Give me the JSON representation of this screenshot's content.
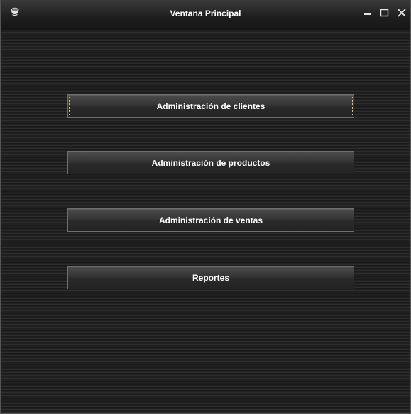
{
  "window": {
    "title": "Ventana Principal",
    "icon": "coffee-cup-icon",
    "controls": {
      "minimize_icon": "minimize-icon",
      "maximize_icon": "maximize-icon",
      "close_icon": "close-icon"
    }
  },
  "menu": {
    "buttons": [
      {
        "label": "Administración de clientes",
        "focused": true
      },
      {
        "label": "Administración de productos",
        "focused": false
      },
      {
        "label": "Administración de ventas",
        "focused": false
      },
      {
        "label": "Reportes",
        "focused": false
      }
    ]
  },
  "colors": {
    "title_text": "#ffffff",
    "button_text": "#ffffff",
    "background": "#1b1b1b",
    "focus_ring": "#d9c36a"
  }
}
